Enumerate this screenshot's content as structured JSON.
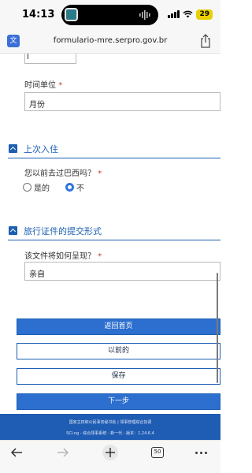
{
  "status_bar": {
    "time": "14:13",
    "battery": "29"
  },
  "browser": {
    "url": "formulario-mre.serpro.gov.br",
    "tab_count": "50"
  },
  "form": {
    "time_unit": {
      "label": "时间单位",
      "required": "*",
      "value": "月份"
    },
    "section_previous_entry": {
      "title": "上次入住"
    },
    "visited_brazil": {
      "label": "您以前去过巴西吗？",
      "required": "*",
      "options": [
        "是的",
        "不"
      ],
      "selected": "不"
    },
    "section_submission": {
      "title": "旅行证件的提交形式"
    },
    "submission_method": {
      "label": "该文件将如何呈现？",
      "required": "*",
      "value": "亲自"
    }
  },
  "buttons": {
    "home": "返回首页",
    "previous": "以前的",
    "save": "保存",
    "next": "下一步"
  },
  "footer": {
    "line1": "国家主权和公民事务秘书处 | 领事管理综合协调",
    "line2": "SCI.ng - 综合领事系统 - 新一代 - 版本：1.24.6.4"
  },
  "colors": {
    "accent": "#1c5fb3",
    "primary_button": "#2d6fcf",
    "footer": "#1f5cb3",
    "battery": "#e8d000"
  }
}
